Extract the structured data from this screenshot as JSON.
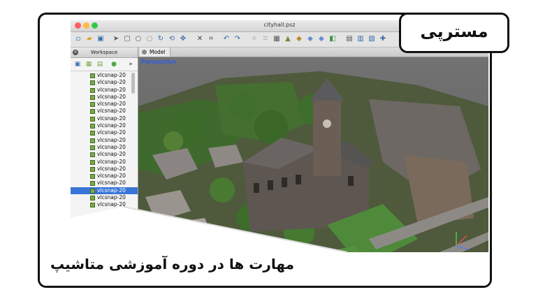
{
  "window": {
    "title": "cityhall.psz"
  },
  "workspace": {
    "title": "Workspace",
    "collapse": "»"
  },
  "tabs": [
    {
      "label": "Model"
    }
  ],
  "viewport": {
    "label": "Perspective"
  },
  "cameras": [
    "vlcsnap-20",
    "vlcsnap-20",
    "vlcsnap-20",
    "vlcsnap-20",
    "vlcsnap-20",
    "vlcsnap-20",
    "vlcsnap-20",
    "vlcsnap-20",
    "vlcsnap-20",
    "vlcsnap-20",
    "vlcsnap-20",
    "vlcsnap-20",
    "vlcsnap-20",
    "vlcsnap-20",
    "vlcsnap-20",
    "vlcsnap-20",
    "vlcsnap-20",
    "vlcsnap-20",
    "vlcsnap-20"
  ],
  "selected_index": 16,
  "brand": {
    "logo": "مسترپی",
    "accent": "#2bb673"
  },
  "caption": "مهارت ها در دوره آموزشی متاشیپ"
}
